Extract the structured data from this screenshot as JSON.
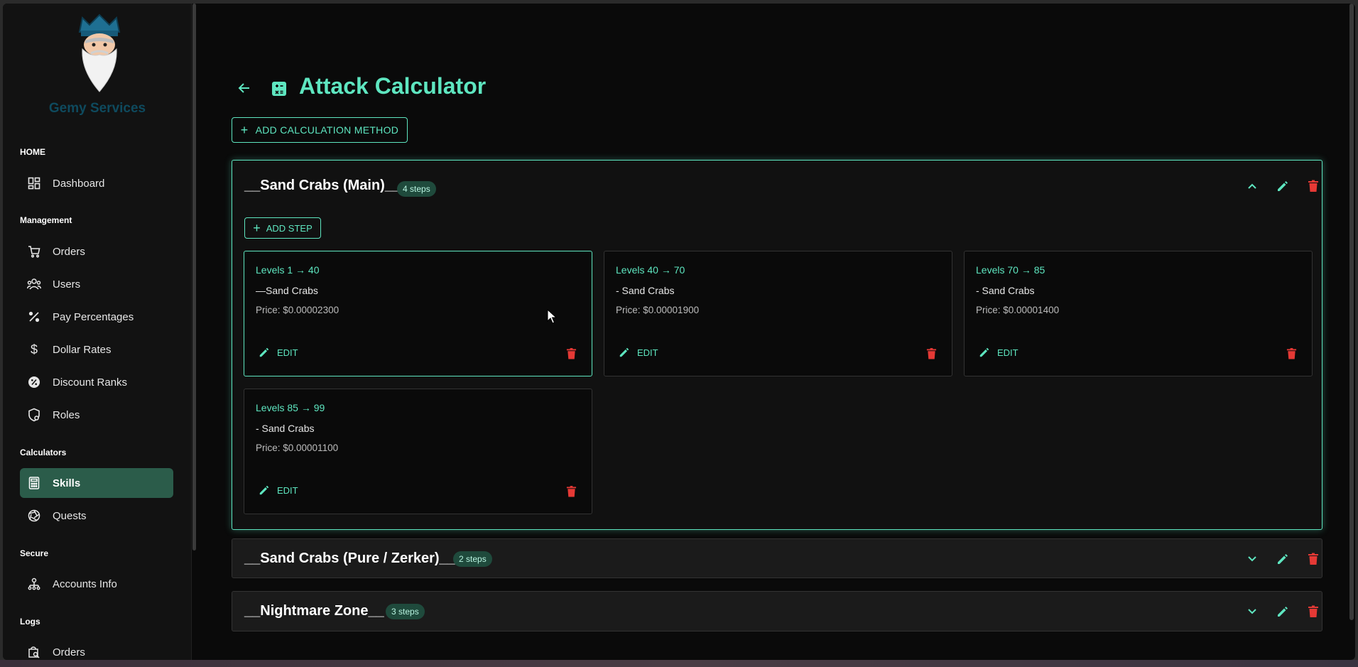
{
  "brand": "Gemy Services",
  "sidebar": {
    "sections": {
      "home": "HOME",
      "management": "Management",
      "calculators": "Calculators",
      "secure": "Secure",
      "logs": "Logs"
    },
    "items": {
      "dashboard": "Dashboard",
      "orders": "Orders",
      "users": "Users",
      "pay_percentages": "Pay Percentages",
      "dollar_rates": "Dollar Rates",
      "discount_ranks": "Discount Ranks",
      "roles": "Roles",
      "skills": "Skills",
      "quests": "Quests",
      "accounts_info": "Accounts Info",
      "log_orders": "Orders"
    },
    "active": "skills"
  },
  "page": {
    "title": "Attack Calculator",
    "add_method_label": "ADD CALCULATION METHOD"
  },
  "methods": [
    {
      "title": "__Sand Crabs (Main)__",
      "badge": "4 steps",
      "expanded": true,
      "add_step_label": "ADD STEP",
      "steps": [
        {
          "levels": "Levels 1 → 40",
          "name": "—Sand Crabs",
          "price": "Price: $0.00002300",
          "edit": "EDIT"
        },
        {
          "levels": "Levels 40 → 70",
          "name": "- Sand Crabs",
          "price": "Price: $0.00001900",
          "edit": "EDIT"
        },
        {
          "levels": "Levels 70 → 85",
          "name": "- Sand Crabs",
          "price": "Price: $0.00001400",
          "edit": "EDIT"
        },
        {
          "levels": "Levels 85 → 99",
          "name": "- Sand Crabs",
          "price": "Price: $0.00001100",
          "edit": "EDIT"
        }
      ]
    },
    {
      "title": "__Sand Crabs (Pure / Zerker)__",
      "badge": "2 steps",
      "expanded": false
    },
    {
      "title": "__Nightmare Zone__",
      "badge": "3 steps",
      "expanded": false
    }
  ],
  "colors": {
    "accent": "#5ee6c0",
    "active_nav": "#2b5c4a",
    "delete": "#e53935",
    "brand_text": "#0e4a5e"
  }
}
